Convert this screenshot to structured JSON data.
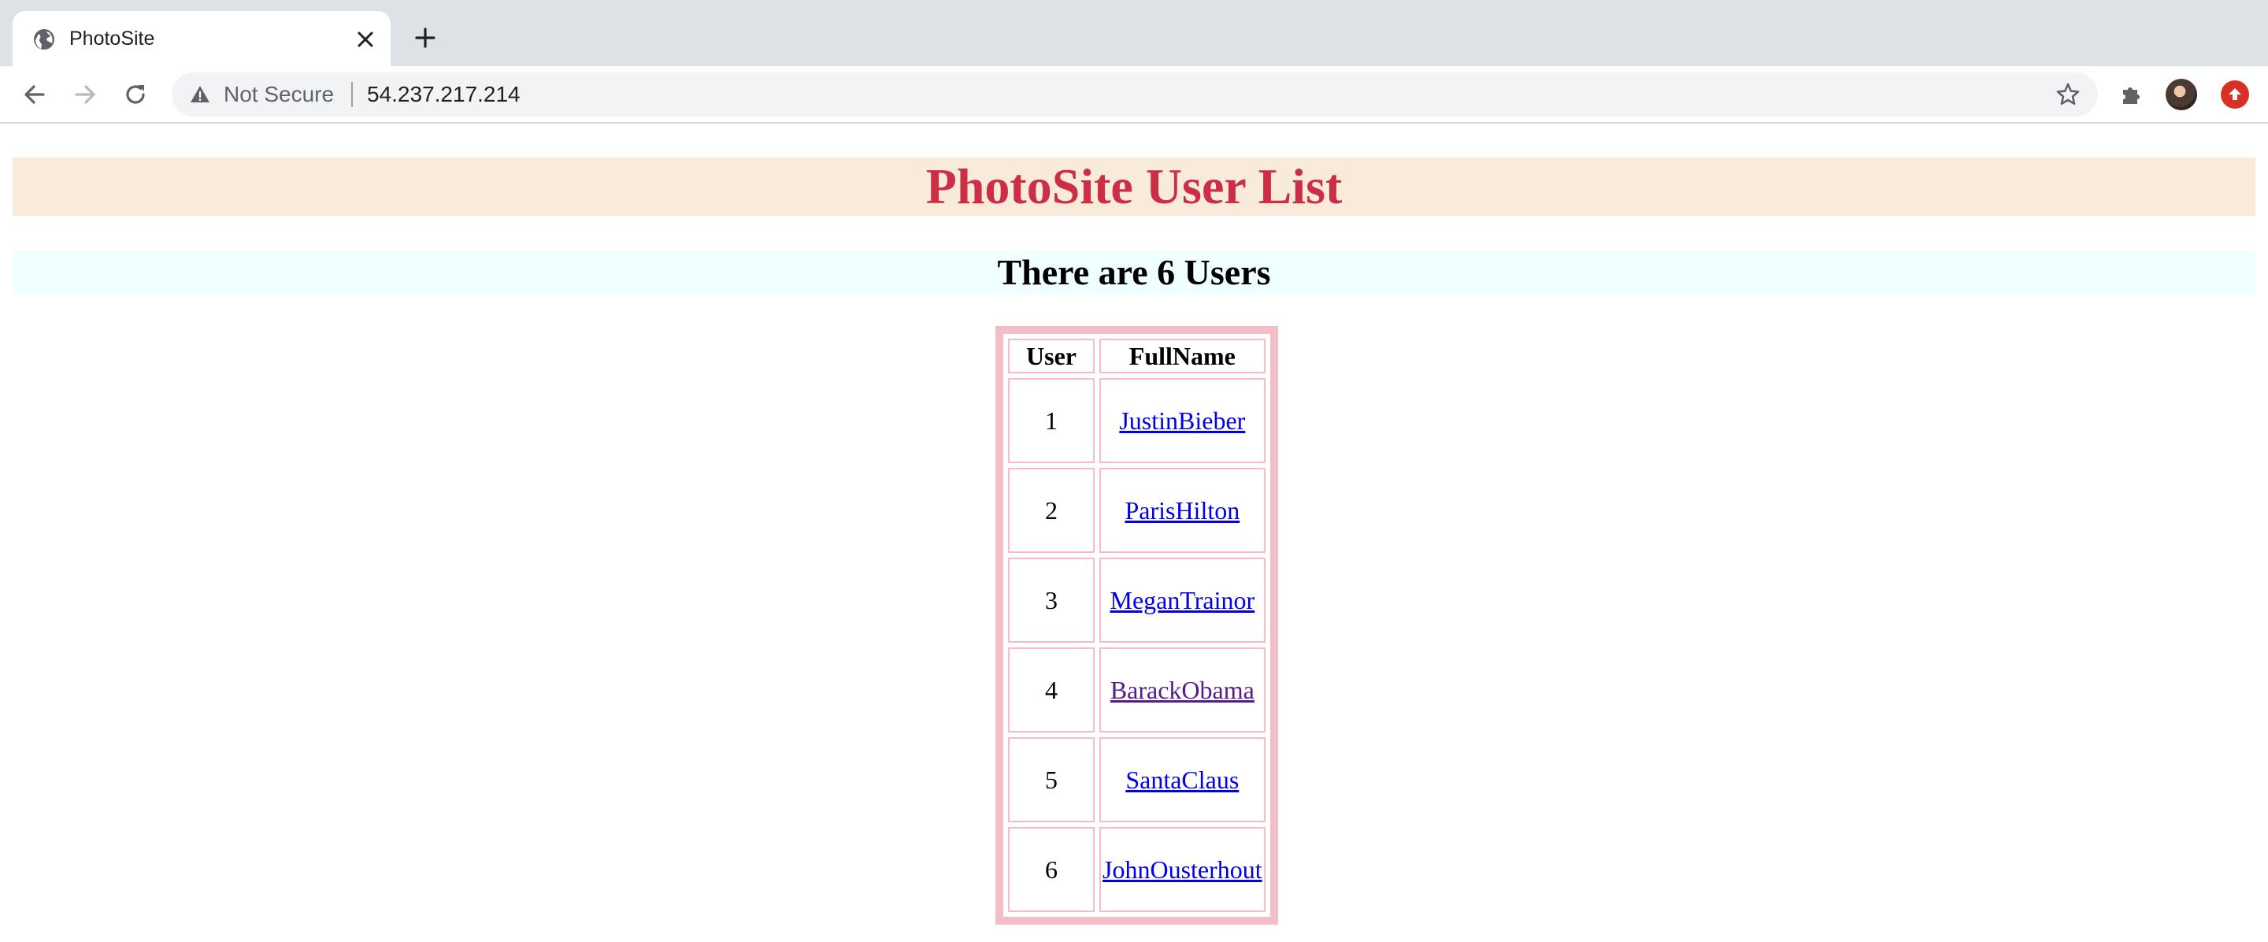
{
  "browser": {
    "tab_title": "PhotoSite",
    "security_label": "Not Secure",
    "url": "54.237.217.214"
  },
  "page": {
    "title": "PhotoSite User List",
    "subtitle": "There are 6 Users",
    "table": {
      "headers": [
        "User",
        "FullName"
      ],
      "rows": [
        {
          "user": "1",
          "name": "JustinBieber",
          "visited": false
        },
        {
          "user": "2",
          "name": "ParisHilton",
          "visited": false
        },
        {
          "user": "3",
          "name": "MeganTrainor",
          "visited": false
        },
        {
          "user": "4",
          "name": "BarackObama",
          "visited": true
        },
        {
          "user": "5",
          "name": "SantaClaus",
          "visited": false
        },
        {
          "user": "6",
          "name": "JohnOusterhout",
          "visited": false
        }
      ]
    }
  },
  "colors": {
    "title_color": "#cc2e45",
    "title_bg": "#f8ebdb",
    "subtitle_bg": "#f0ffff",
    "table_border": "#f4bec8",
    "link": "#0000ee",
    "link_visited": "#551a8b"
  },
  "icons": {
    "tab_favicon": "globe-icon",
    "tab_close": "close-icon",
    "new_tab": "plus-icon",
    "back": "arrow-left-icon",
    "forward": "arrow-right-icon",
    "reload": "reload-icon",
    "security": "warning-triangle-icon",
    "bookmark": "star-icon",
    "extensions": "puzzle-icon",
    "profile": "avatar",
    "update": "update-arrow-icon"
  }
}
